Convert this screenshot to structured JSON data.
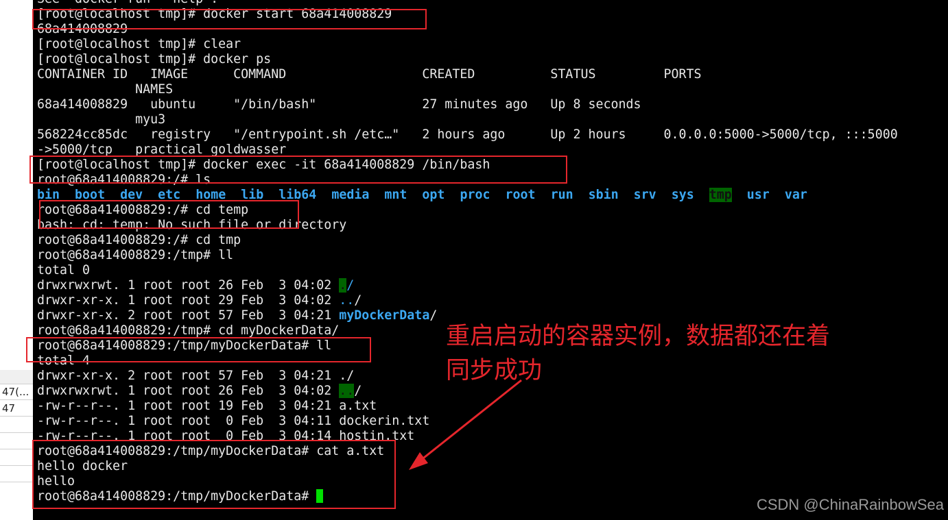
{
  "side_table": {
    "rows": [
      "47(...",
      "47",
      "",
      "",
      "",
      ""
    ]
  },
  "terminal": {
    "lines": [
      [
        {
          "t": "See 'docker run --help'."
        }
      ],
      [
        {
          "t": "[root@localhost tmp]# docker start 68a414008829"
        }
      ],
      [
        {
          "t": "68a414008829"
        }
      ],
      [
        {
          "t": "[root@localhost tmp]# clear"
        }
      ],
      [
        {
          "t": "[root@localhost tmp]# docker ps"
        }
      ],
      [
        {
          "t": "CONTAINER ID   IMAGE      COMMAND                  CREATED          STATUS         PORTS"
        }
      ],
      [
        {
          "t": "             NAMES"
        }
      ],
      [
        {
          "t": "68a414008829   ubuntu     \"/bin/bash\"              27 minutes ago   Up 8 seconds"
        }
      ],
      [
        {
          "t": "             myu3"
        }
      ],
      [
        {
          "t": "568224cc85dc   registry   \"/entrypoint.sh /etc…\"   2 hours ago      Up 2 hours     0.0.0.0:5000->5000/tcp, :::5000"
        }
      ],
      [
        {
          "t": "->5000/tcp   practical_goldwasser"
        }
      ],
      [
        {
          "t": "[root@localhost tmp]# docker exec -it 68a414008829 /bin/bash"
        }
      ],
      [
        {
          "t": "root@68a414008829:/# ls"
        }
      ],
      [
        {
          "t": "bin",
          "c": "dir"
        },
        {
          "t": "  "
        },
        {
          "t": "boot",
          "c": "dir"
        },
        {
          "t": "  "
        },
        {
          "t": "dev",
          "c": "dir"
        },
        {
          "t": "  "
        },
        {
          "t": "etc",
          "c": "dir"
        },
        {
          "t": "  "
        },
        {
          "t": "home",
          "c": "dir"
        },
        {
          "t": "  "
        },
        {
          "t": "lib",
          "c": "dir"
        },
        {
          "t": "  "
        },
        {
          "t": "lib64",
          "c": "dir"
        },
        {
          "t": "  "
        },
        {
          "t": "media",
          "c": "dir"
        },
        {
          "t": "  "
        },
        {
          "t": "mnt",
          "c": "dir"
        },
        {
          "t": "  "
        },
        {
          "t": "opt",
          "c": "dir"
        },
        {
          "t": "  "
        },
        {
          "t": "proc",
          "c": "dir"
        },
        {
          "t": "  "
        },
        {
          "t": "root",
          "c": "dir"
        },
        {
          "t": "  "
        },
        {
          "t": "run",
          "c": "dir"
        },
        {
          "t": "  "
        },
        {
          "t": "sbin",
          "c": "dir"
        },
        {
          "t": "  "
        },
        {
          "t": "srv",
          "c": "dir"
        },
        {
          "t": "  "
        },
        {
          "t": "sys",
          "c": "dir"
        },
        {
          "t": "  "
        },
        {
          "t": "tmp",
          "c": "gbgb"
        },
        {
          "t": "  "
        },
        {
          "t": "usr",
          "c": "dir"
        },
        {
          "t": "  "
        },
        {
          "t": "var",
          "c": "dir"
        }
      ],
      [
        {
          "t": "root@68a414008829:/# cd temp"
        }
      ],
      [
        {
          "t": "bash: cd: temp: No such file or directory"
        }
      ],
      [
        {
          "t": "root@68a414008829:/# cd tmp"
        }
      ],
      [
        {
          "t": "root@68a414008829:/tmp# ll"
        }
      ],
      [
        {
          "t": "total 0"
        }
      ],
      [
        {
          "t": "drwxrwxrwt. 1 root root 26 Feb  3 04:02 "
        },
        {
          "t": ".",
          "c": "gbg"
        },
        {
          "t": "/",
          "c": "blue"
        }
      ],
      [
        {
          "t": "drwxr-xr-x. 1 root root 29 Feb  3 04:02 "
        },
        {
          "t": "..",
          "c": "blue"
        },
        {
          "t": "/"
        }
      ],
      [
        {
          "t": "drwxr-xr-x. 2 root root 57 Feb  3 04:21 "
        },
        {
          "t": "myDockerData",
          "c": "dir"
        },
        {
          "t": "/"
        }
      ],
      [
        {
          "t": "root@68a414008829:/tmp# cd myDockerData/"
        }
      ],
      [
        {
          "t": "root@68a414008829:/tmp/myDockerData# ll"
        }
      ],
      [
        {
          "t": "total 4"
        }
      ],
      [
        {
          "t": "drwxr-xr-x. 2 root root 57 Feb  3 04:21 ./"
        }
      ],
      [
        {
          "t": "drwxrwxrwt. 1 root root 26 Feb  3 04:02 "
        },
        {
          "t": "..",
          "c": "gbg"
        },
        {
          "t": "/"
        }
      ],
      [
        {
          "t": "-rw-r--r--. 1 root root 19 Feb  3 04:21 a.txt"
        }
      ],
      [
        {
          "t": "-rw-r--r--. 1 root root  0 Feb  3 04:11 dockerin.txt"
        }
      ],
      [
        {
          "t": "-rw-r--r--. 1 root root  0 Feb  3 04:14 hostin.txt"
        }
      ],
      [
        {
          "t": "root@68a414008829:/tmp/myDockerData# cat a.txt"
        }
      ],
      [
        {
          "t": "hello docker"
        }
      ],
      [
        {
          "t": "hello"
        }
      ],
      [
        {
          "t": "root@68a414008829:/tmp/myDockerData# "
        },
        {
          "t": "",
          "c": "cursor"
        }
      ]
    ]
  },
  "annotation": {
    "line1": "重启启动的容器实例，数据都还在着",
    "line2": "同步成功",
    "color": "#e5262c"
  },
  "watermark": "CSDN @ChinaRainbowSea"
}
